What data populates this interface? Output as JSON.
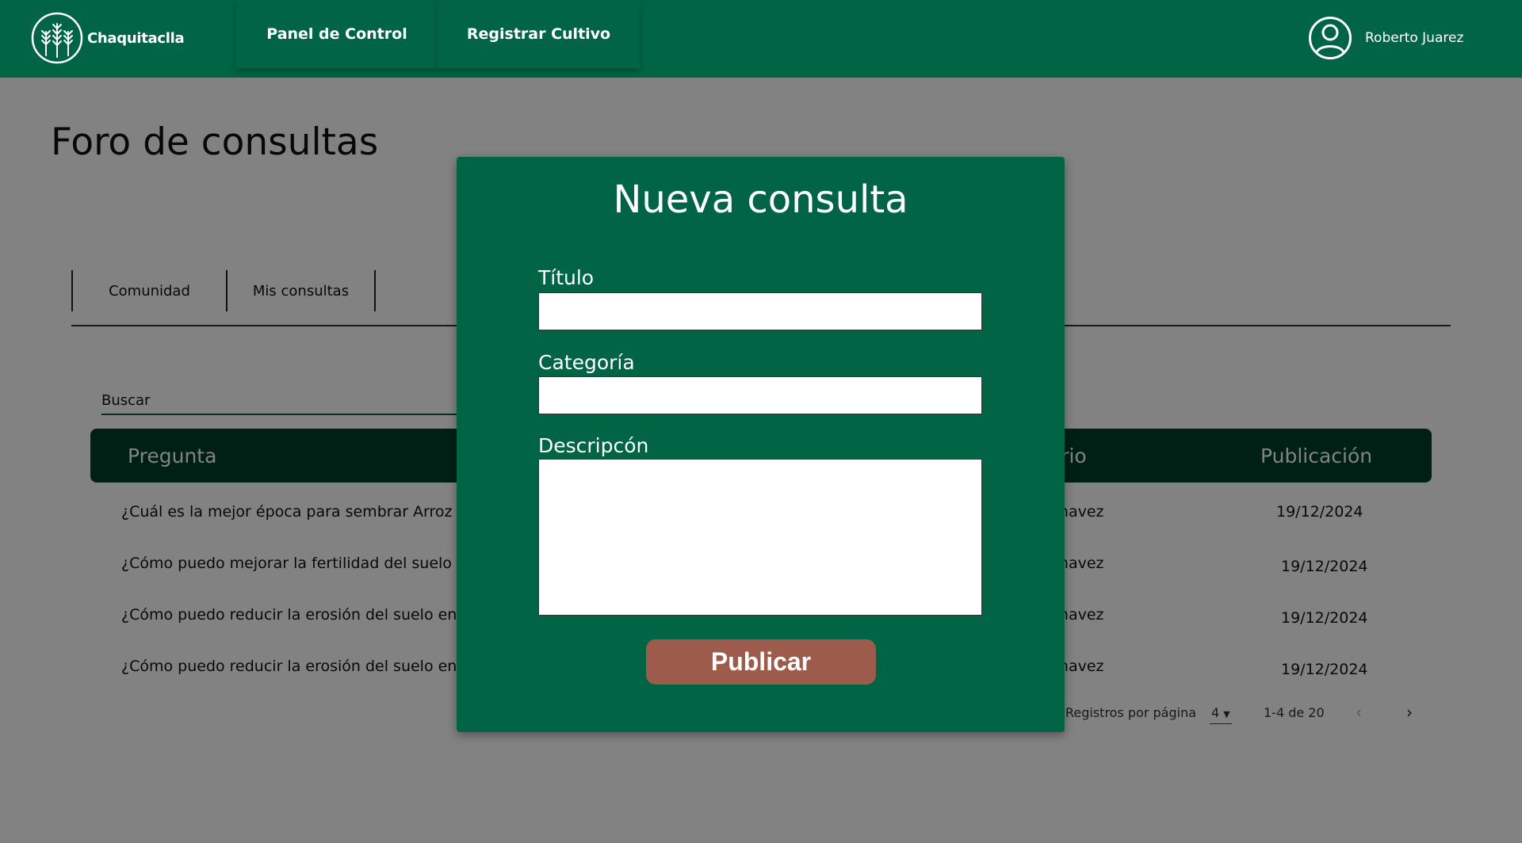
{
  "colors": {
    "brand_green": "#006445",
    "dark_green": "#00402a",
    "publish_button": "#9c5b4b",
    "overlay": "rgba(0,0,0,0.49)"
  },
  "header": {
    "logo_text": "Chaquitaclla",
    "nav": [
      "Panel de Control",
      "Registrar Cultivo"
    ],
    "user_name": "Roberto Juarez",
    "user_icon": "user-circle-icon"
  },
  "page": {
    "title": "Foro de consultas",
    "tabs": [
      "Comunidad",
      "Mis consultas"
    ],
    "search_placeholder": "Buscar",
    "table": {
      "headers": {
        "question": "Pregunta",
        "user": "suario",
        "publication": "Publicación"
      },
      "rows": [
        {
          "question": "¿Cuál es la mejor época para sembrar Arroz en",
          "user": "ex Chavez",
          "date": "19/12/2024"
        },
        {
          "question": "¿Cómo puedo mejorar la fertilidad del suelo de",
          "user": "ex Chavez",
          "date": "19/12/2024"
        },
        {
          "question": "¿Cómo puedo reducir la erosión del suelo en m",
          "user": "ex Chavez",
          "date": "19/12/2024"
        },
        {
          "question": "¿Cómo puedo reducir la erosión del suelo en m",
          "user": "ex Chavez",
          "date": "19/12/2024"
        }
      ]
    },
    "pagination": {
      "label": "Registros por página",
      "per_page": "4",
      "range": "1-4 de 20"
    }
  },
  "modal": {
    "title": "Nueva consulta",
    "fields": {
      "title_label": "Título",
      "category_label": "Categoría",
      "description_label": "Descripcón"
    },
    "values": {
      "title": "",
      "category": "",
      "description": ""
    },
    "publish_label": "Publicar"
  }
}
